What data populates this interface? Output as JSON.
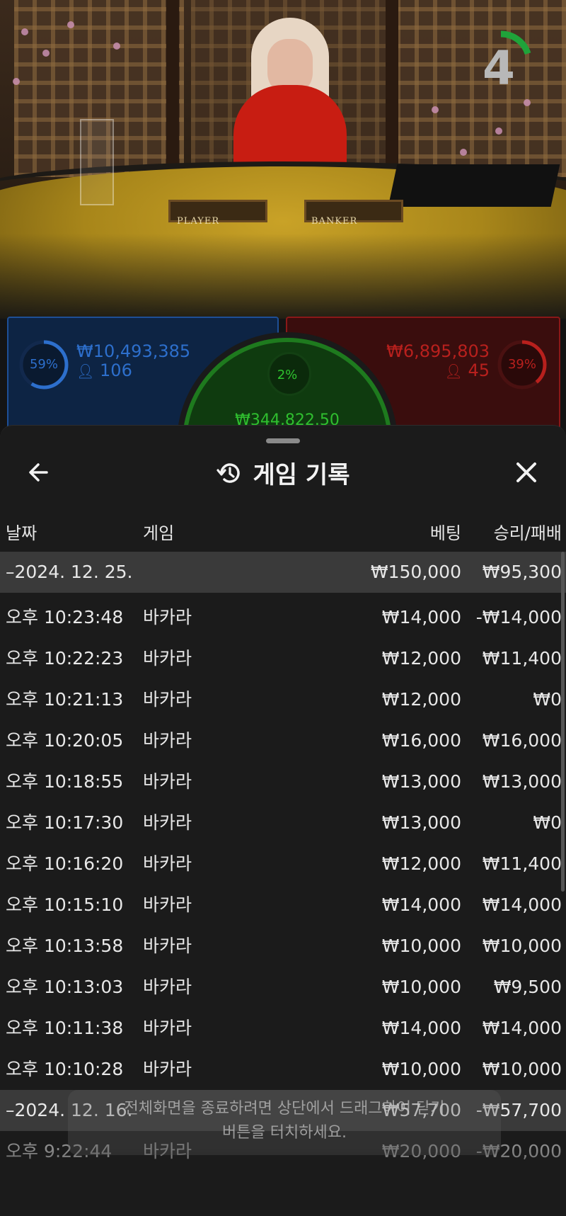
{
  "timer": {
    "value": "4",
    "progress": 0.2
  },
  "table_labels": {
    "player": "PLAYER",
    "banker": "BANKER"
  },
  "bets": {
    "player": {
      "percent": "59%",
      "amount": "₩10,493,385",
      "count": "106",
      "color": "#2d6fcc"
    },
    "banker": {
      "percent": "39%",
      "amount": "₩6,895,803",
      "count": "45",
      "color": "#b8201d"
    },
    "tie": {
      "percent": "2%",
      "amount": "₩344,822.50",
      "color": "#2fbf2f"
    }
  },
  "history": {
    "title": "게임 기록",
    "columns": {
      "date": "날짜",
      "game": "게임",
      "bet": "베팅",
      "result": "승리/패배"
    },
    "groups": [
      {
        "date": "–2024. 12. 25.",
        "bet_total": "₩150,000",
        "result_total": "₩95,300",
        "rows": [
          {
            "time": "오후 10:23:48",
            "game": "바카라",
            "bet": "₩14,000",
            "result": "-₩14,000"
          },
          {
            "time": "오후 10:22:23",
            "game": "바카라",
            "bet": "₩12,000",
            "result": "₩11,400"
          },
          {
            "time": "오후 10:21:13",
            "game": "바카라",
            "bet": "₩12,000",
            "result": "₩0"
          },
          {
            "time": "오후 10:20:05",
            "game": "바카라",
            "bet": "₩16,000",
            "result": "₩16,000"
          },
          {
            "time": "오후 10:18:55",
            "game": "바카라",
            "bet": "₩13,000",
            "result": "₩13,000"
          },
          {
            "time": "오후 10:17:30",
            "game": "바카라",
            "bet": "₩13,000",
            "result": "₩0"
          },
          {
            "time": "오후 10:16:20",
            "game": "바카라",
            "bet": "₩12,000",
            "result": "₩11,400"
          },
          {
            "time": "오후 10:15:10",
            "game": "바카라",
            "bet": "₩14,000",
            "result": "₩14,000"
          },
          {
            "time": "오후 10:13:58",
            "game": "바카라",
            "bet": "₩10,000",
            "result": "₩10,000"
          },
          {
            "time": "오후 10:13:03",
            "game": "바카라",
            "bet": "₩10,000",
            "result": "₩9,500"
          },
          {
            "time": "오후 10:11:38",
            "game": "바카라",
            "bet": "₩14,000",
            "result": "₩14,000"
          },
          {
            "time": "오후 10:10:28",
            "game": "바카라",
            "bet": "₩10,000",
            "result": "₩10,000"
          }
        ]
      },
      {
        "date": "–2024. 12. 16.",
        "bet_total": "₩57,700",
        "result_total": "-₩57,700",
        "rows": [
          {
            "time": "오후 9:22:44",
            "game": "바카라",
            "bet": "₩20,000",
            "result": "-₩20,000"
          }
        ]
      }
    ]
  },
  "toast": {
    "line1": "전체화면을 종료하려면 상단에서 드래그하여 닫기",
    "line2": "버튼을 터치하세요."
  }
}
